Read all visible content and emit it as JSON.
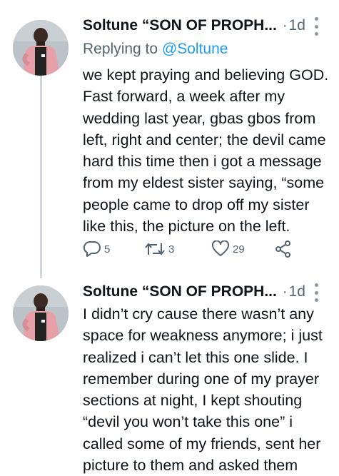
{
  "tweets": [
    {
      "author_name": "Soltune “SON OF PROPH...",
      "time": "1d",
      "replying_prefix": "Replying to",
      "replying_handle": "@Soltune",
      "text": "we kept praying and believing GOD. Fast forward, a week after my wedding last year, gbas gbos from left, right and center; the devil came hard this time then i got a message from my eldest sister saying, “some people came to drop off my sister like this, the picture on the left.",
      "replies": "5",
      "retweets": "3",
      "likes": "29"
    },
    {
      "author_name": "Soltune “SON OF PROPH...",
      "time": "1d",
      "text": "I didn’t cry cause there wasn’t any space for weakness anymore; i just realized i can’t let this one slide. I remember during one of my prayer sections at night, I kept shouting “devil you won’t take this one” i called some of my friends, sent her picture to them and asked them"
    }
  ],
  "icons": {
    "reply": "reply-icon",
    "retweet": "retweet-icon",
    "like": "heart-icon",
    "share": "share-icon",
    "more": "more-icon"
  },
  "colors": {
    "link": "#1d9bf0",
    "secondary_text": "#536471",
    "thread_line": "#cfd9de",
    "jacket_pink": "#e8a0a8"
  }
}
